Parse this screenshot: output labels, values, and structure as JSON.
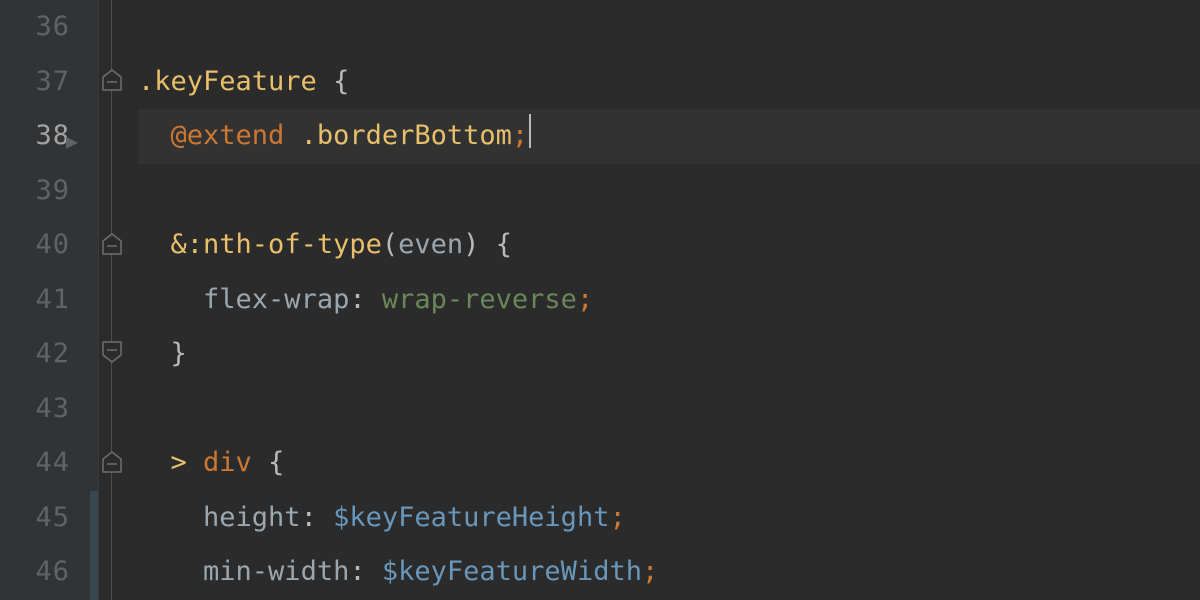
{
  "gutter": {
    "start": 36,
    "end": 46,
    "current": 38
  },
  "fold_handles": [
    {
      "row": 37,
      "shape": "minus"
    },
    {
      "row": 40,
      "shape": "minus"
    },
    {
      "row": 42,
      "shape": "close"
    },
    {
      "row": 44,
      "shape": "minus"
    }
  ],
  "lines": {
    "l36": {
      "indent": ""
    },
    "l37": {
      "selector_class": ".keyFeature",
      "brace_open": "{"
    },
    "l38": {
      "at_extend": "@extend",
      "ext_target": ".borderBottom",
      "semi": ";"
    },
    "l39": {
      "indent": ""
    },
    "l40": {
      "amp": "&",
      "pseudo": ":nth-of-type",
      "paren_open": "(",
      "arg": "even",
      "paren_close": ")",
      "brace_open": "{"
    },
    "l41": {
      "prop": "flex-wrap",
      "colon": ":",
      "value": "wrap-reverse",
      "semi": ";"
    },
    "l42": {
      "brace_close": "}"
    },
    "l43": {
      "indent": ""
    },
    "l44": {
      "combinator": ">",
      "tag": "div",
      "brace_open": "{"
    },
    "l45": {
      "prop": "height",
      "colon": ":",
      "var": "$keyFeatureHeight",
      "semi": ";"
    },
    "l46": {
      "prop": "min-width",
      "colon": ":",
      "var": "$keyFeatureWidth",
      "semi": ";"
    }
  }
}
